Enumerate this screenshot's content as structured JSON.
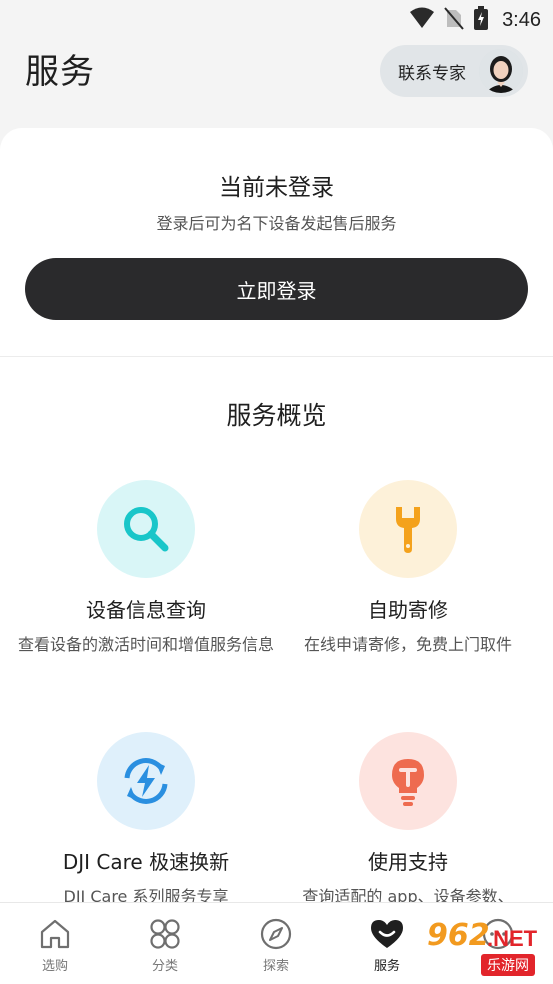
{
  "status_bar": {
    "time": "3:46",
    "icons": [
      "wifi-icon",
      "no-sim-icon",
      "battery-charging-icon"
    ]
  },
  "header": {
    "title": "服务",
    "contact_expert": "联系专家"
  },
  "login": {
    "title": "当前未登录",
    "subtitle": "登录后可为名下设备发起售后服务",
    "button": "立即登录"
  },
  "overview": {
    "title": "服务概览",
    "items": [
      {
        "name": "设备信息查询",
        "desc": "查看设备的激活时间和增值服务信息",
        "icon": "search-icon",
        "bg": "#d9f6f7",
        "color": "#19c6c9"
      },
      {
        "name": "自助寄修",
        "desc": "在线申请寄修，免费上门取件",
        "icon": "wrench-icon",
        "bg": "#fdf1d9",
        "color": "#f4a21c"
      },
      {
        "name": "DJI Care 极速换新",
        "desc": "DJI Care 系列服务专享",
        "icon": "refresh-bolt-icon",
        "bg": "#dff0fb",
        "color": "#2a8fe0"
      },
      {
        "name": "使用支持",
        "desc": "查询适配的 app、设备参数、",
        "icon": "bulb-icon",
        "bg": "#fde3df",
        "color": "#ee6b4f"
      }
    ]
  },
  "tab_bar": {
    "items": [
      {
        "label": "选购",
        "icon": "home-icon"
      },
      {
        "label": "分类",
        "icon": "grid-icon"
      },
      {
        "label": "探索",
        "icon": "compass-icon"
      },
      {
        "label": "服务",
        "icon": "heart-smile-icon",
        "active": true
      },
      {
        "label": "",
        "icon": "chat-icon"
      }
    ]
  },
  "watermark": {
    "number": "962",
    "suffix": ".NET",
    "sub": "乐游网"
  }
}
